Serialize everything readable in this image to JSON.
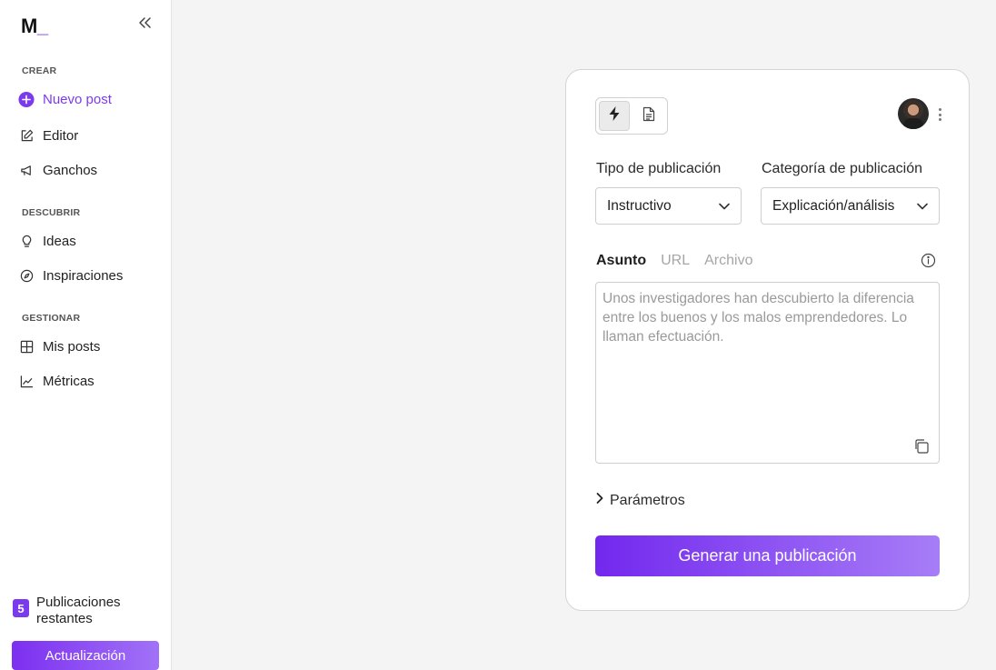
{
  "brand": {
    "logo_letter": "M",
    "logo_cursor": "_"
  },
  "sidebar": {
    "sections": [
      {
        "label": "CREAR"
      },
      {
        "label": "DESCUBRIR"
      },
      {
        "label": "GESTIONAR"
      }
    ],
    "items": [
      {
        "label": "Nuevo post",
        "icon": "plus-circle-icon"
      },
      {
        "label": "Editor",
        "icon": "edit-icon"
      },
      {
        "label": "Ganchos",
        "icon": "megaphone-icon"
      },
      {
        "label": "Ideas",
        "icon": "lightbulb-icon"
      },
      {
        "label": "Inspiraciones",
        "icon": "compass-icon"
      },
      {
        "label": "Mis posts",
        "icon": "grid-icon"
      },
      {
        "label": "Métricas",
        "icon": "chart-icon"
      }
    ],
    "remaining": {
      "count": "5",
      "text": "Publicaciones restantes"
    },
    "upgrade_label": "Actualización"
  },
  "form": {
    "post_type": {
      "label": "Tipo de publicación",
      "value": "Instructivo"
    },
    "post_category": {
      "label": "Categoría de publicación",
      "value": "Explicación/análisis"
    },
    "source_tabs": [
      {
        "label": "Asunto",
        "active": true
      },
      {
        "label": "URL",
        "active": false
      },
      {
        "label": "Archivo",
        "active": false
      }
    ],
    "subject_placeholder": "Unos investigadores han descubierto la diferencia entre los buenos y los malos emprendedores. Lo llaman efectuación.",
    "params_label": "Parámetros",
    "generate_label": "Generar una publicación"
  },
  "colors": {
    "accent": "#7c3aed",
    "accent_light": "#a77df7",
    "background": "#f4f4f4"
  }
}
